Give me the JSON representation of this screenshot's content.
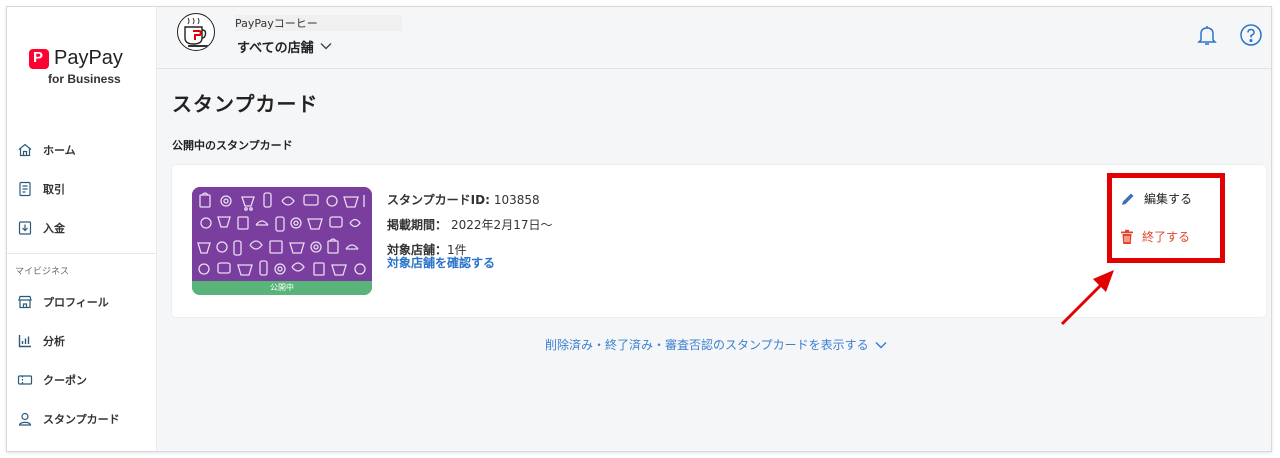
{
  "brand": {
    "name": "PayPay",
    "sub": "for Business",
    "accent": "#ff0033"
  },
  "sidebar": {
    "items": [
      {
        "label": "ホーム",
        "icon": "home-icon"
      },
      {
        "label": "取引",
        "icon": "receipt-icon"
      },
      {
        "label": "入金",
        "icon": "deposit-icon"
      }
    ],
    "section_label": "マイビジネス",
    "business_items": [
      {
        "label": "プロフィール",
        "icon": "store-icon"
      },
      {
        "label": "分析",
        "icon": "chart-icon"
      },
      {
        "label": "クーポン",
        "icon": "coupon-icon"
      },
      {
        "label": "スタンプカード",
        "icon": "user-card-icon"
      }
    ]
  },
  "header": {
    "store_name": "PayPayコーヒー",
    "store_select": "すべての店舗"
  },
  "main": {
    "page_title": "スタンプカード",
    "section_title": "公開中のスタンプカード",
    "card": {
      "status": "公開中",
      "id_label": "スタンプカードID:",
      "id_value": "103858",
      "period_label": "掲載期間：",
      "period_value": "2022年2月17日〜",
      "stores_label": "対象店舗：",
      "stores_value": "1件",
      "stores_link": "対象店舗を確認する",
      "edit_label": "編集する",
      "end_label": "終了する"
    },
    "show_more": "削除済み・終了済み・審査否認のスタンプカードを表示する"
  },
  "colors": {
    "link": "#2b73c9",
    "danger": "#e2452d",
    "highlight": "#e30000",
    "status_green": "#58b478",
    "card_purple": "#7a3f9e"
  }
}
